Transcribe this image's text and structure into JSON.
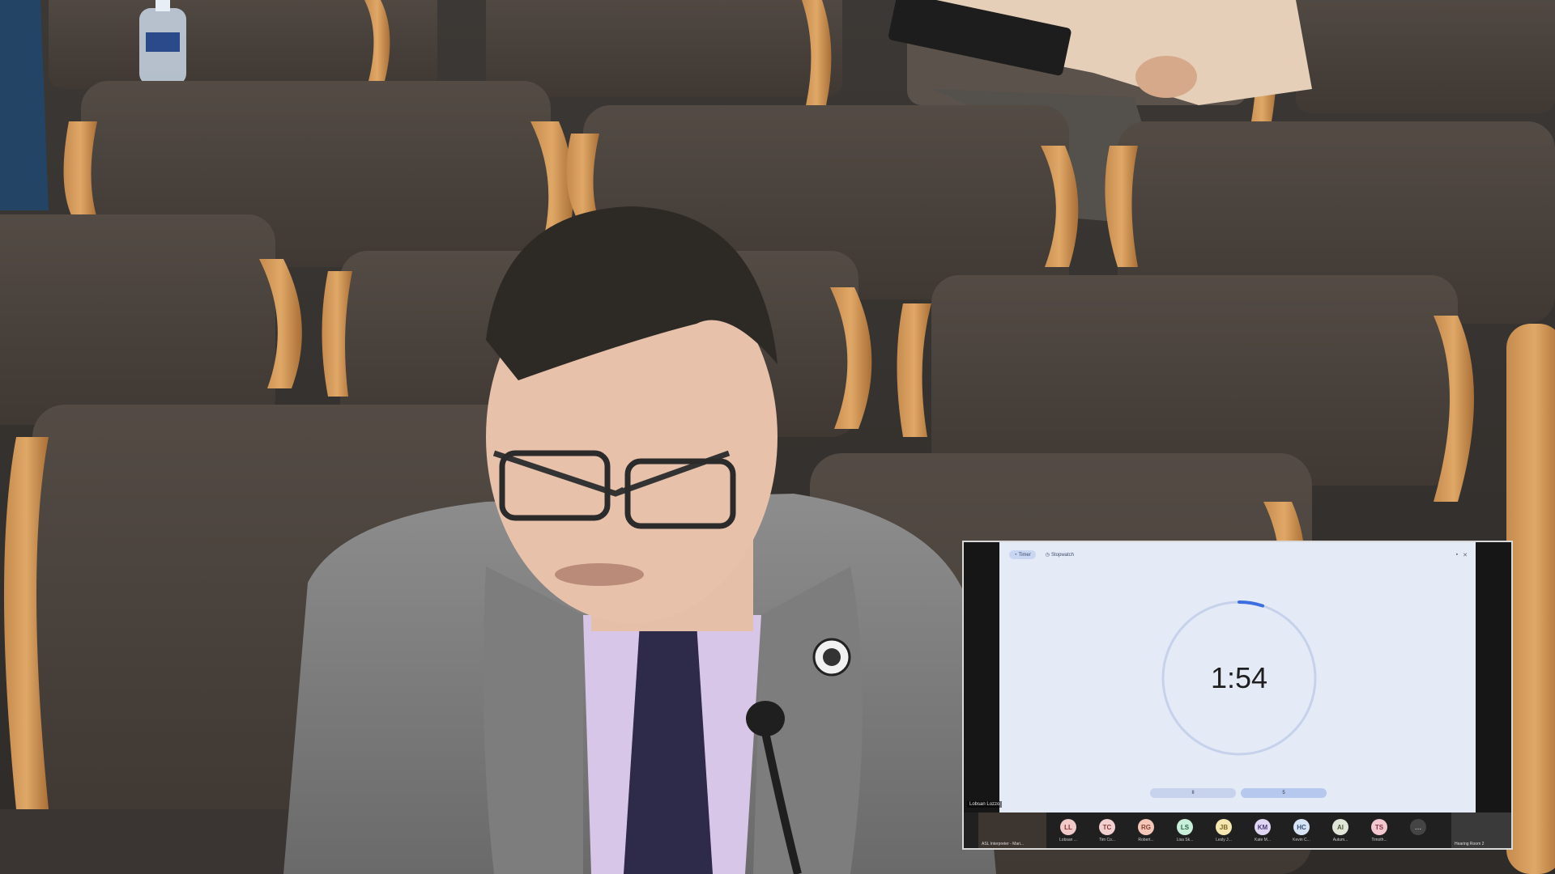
{
  "pip": {
    "tabs": [
      {
        "label": "Timer",
        "icon": "timer-icon",
        "active": true
      },
      {
        "label": "Stopwatch",
        "icon": "stopwatch-icon",
        "active": false
      }
    ],
    "timer": {
      "value": "1:54",
      "progress_fraction": 0.05
    },
    "controls": {
      "left_label": "II",
      "right_label": "5"
    },
    "speaker_label": "Lobsan Lozzo",
    "first_thumb_caption": "ASL Interpreter - Mari...",
    "participants": [
      {
        "initials": "LL",
        "name": "Lobsan ...",
        "bg": "#f1c9c9",
        "fg": "#8a3030"
      },
      {
        "initials": "TC",
        "name": "Tim Co...",
        "bg": "#f3d0d0",
        "fg": "#8a3a3a"
      },
      {
        "initials": "RG",
        "name": "Robert...",
        "bg": "#f5c7b8",
        "fg": "#8a4030"
      },
      {
        "initials": "LS",
        "name": "Lisa Sk...",
        "bg": "#c9eed9",
        "fg": "#2a6a44"
      },
      {
        "initials": "JB",
        "name": "Lesly J...",
        "bg": "#f4e7b0",
        "fg": "#7a6420"
      },
      {
        "initials": "KM",
        "name": "Kate M...",
        "bg": "#e0d6f3",
        "fg": "#4a3a7a"
      },
      {
        "initials": "HC",
        "name": "Kevin C...",
        "bg": "#d7e3f6",
        "fg": "#34507a"
      },
      {
        "initials": "AI",
        "name": "Autum...",
        "bg": "#dfe6d8",
        "fg": "#4a5a3a"
      },
      {
        "initials": "TS",
        "name": "Timoth...",
        "bg": "#f3c7cf",
        "fg": "#8a3040"
      }
    ],
    "more_label": "...",
    "last_thumb_caption": "Hearing Room 2"
  }
}
